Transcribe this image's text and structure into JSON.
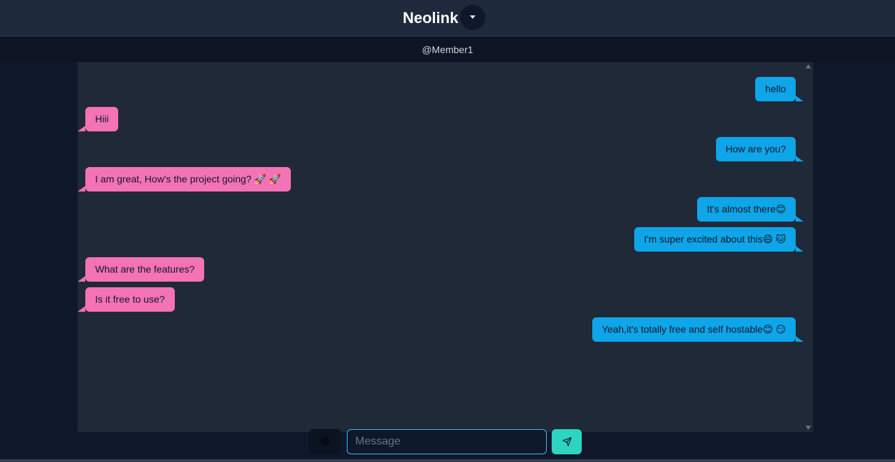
{
  "header": {
    "title": "Neolink"
  },
  "user_bar": {
    "handle": "@Member1"
  },
  "messages": [
    {
      "side": "sent",
      "text": "hello"
    },
    {
      "side": "received",
      "text": "Hiii"
    },
    {
      "side": "sent",
      "text": "How are you?"
    },
    {
      "side": "received",
      "text": "I am great, How's the project going? 🚀 🚀"
    },
    {
      "side": "sent",
      "text": "It's almost there😊"
    },
    {
      "side": "sent",
      "text": "I'm super excited about this😄 🐱"
    },
    {
      "side": "received",
      "text": "What are the features?"
    },
    {
      "side": "received",
      "text": "Is it free to use?"
    },
    {
      "side": "sent",
      "text": "Yeah,it's totally free and self hostable😊 😏"
    }
  ],
  "composer": {
    "emoji_icon": "😄",
    "placeholder": "Message",
    "value": ""
  },
  "colors": {
    "sent_bubble": "#0ea5e9",
    "received_bubble": "#f472b6",
    "send_button": "#2dd4bf",
    "input_border": "#38bdf8"
  }
}
